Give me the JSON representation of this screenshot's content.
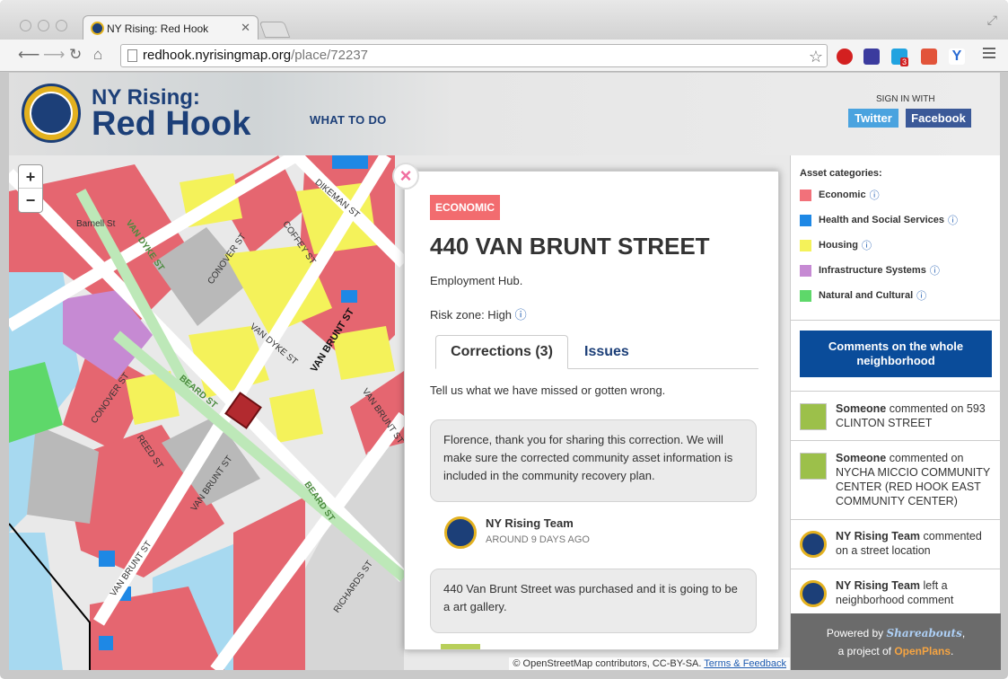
{
  "browser": {
    "tab_title": "NY Rising: Red Hook",
    "url_host": "redhook.nyrisingmap.org",
    "url_path": "/place/72237",
    "extension_badge": "3"
  },
  "site": {
    "title_line1": "NY Rising:",
    "title_line2": "Red Hook",
    "nav_what_to_do": "WHAT TO DO",
    "sign_in_label": "SIGN IN WITH",
    "twitter_label": "Twitter",
    "facebook_label": "Facebook"
  },
  "map": {
    "zoom_in": "+",
    "zoom_out": "−",
    "attribution": "© OpenStreetMap contributors, CC-BY-SA.",
    "terms_link": "Terms & Feedback",
    "street_labels": [
      "Barnell St",
      "VAN DYKE ST",
      "CONOVER ST",
      "COFFEY ST",
      "DIKEMAN ST",
      "VAN BRUNT ST",
      "VAN DYKE ST",
      "BEARD ST",
      "CONOVER ST",
      "REED ST",
      "VAN BRUNT ST",
      "VAN BRUNT ST",
      "BEARD ST",
      "RICHARDS ST",
      "VAN BRUNT ST"
    ]
  },
  "popup": {
    "close": "×",
    "category": "ECONOMIC",
    "title": "440 VAN BRUNT STREET",
    "description": "Employment Hub.",
    "risk_zone": "Risk zone: High",
    "risk_info": "ⓘ",
    "tabs": [
      {
        "label": "Corrections (3)",
        "active": true
      },
      {
        "label": "Issues",
        "active": false
      }
    ],
    "prompt": "Tell us what we have missed or gotten wrong.",
    "comments": [
      {
        "text": "Florence, thank you for sharing this correction. We will make sure the corrected community asset information is included in the community recovery plan.",
        "author": "NY Rising Team",
        "time": "AROUND 9 DAYS AGO"
      },
      {
        "text": "440 Van Brunt Street was purchased and it is going to be a art gallery."
      }
    ]
  },
  "sidebar": {
    "legend_title": "Asset categories:",
    "categories": [
      {
        "label": "Economic",
        "color": "#f2717a"
      },
      {
        "label": "Health and Social Services",
        "color": "#1e88e5"
      },
      {
        "label": "Housing",
        "color": "#f4f25a"
      },
      {
        "label": "Infrastructure Systems",
        "color": "#c68ad3"
      },
      {
        "label": "Natural and Cultural",
        "color": "#5ed86a"
      }
    ],
    "info_icon": "ⓘ",
    "neighborhood_button": "Comments on the whole neighborhood",
    "activity": [
      {
        "user": "Someone",
        "text": " commented on 593 CLINTON STREET"
      },
      {
        "user": "Someone",
        "text": " commented on NYCHA MICCIO COMMUNITY CENTER (RED HOOK EAST COMMUNITY CENTER)"
      },
      {
        "user": "NY Rising Team",
        "text": " commented on a street location"
      },
      {
        "user": "NY Rising Team",
        "text": " left a neighborhood comment"
      }
    ],
    "footer_powered": "Powered by ",
    "footer_brand": "Shareabouts",
    "footer_project": "a project of ",
    "footer_org": "OpenPlans"
  }
}
